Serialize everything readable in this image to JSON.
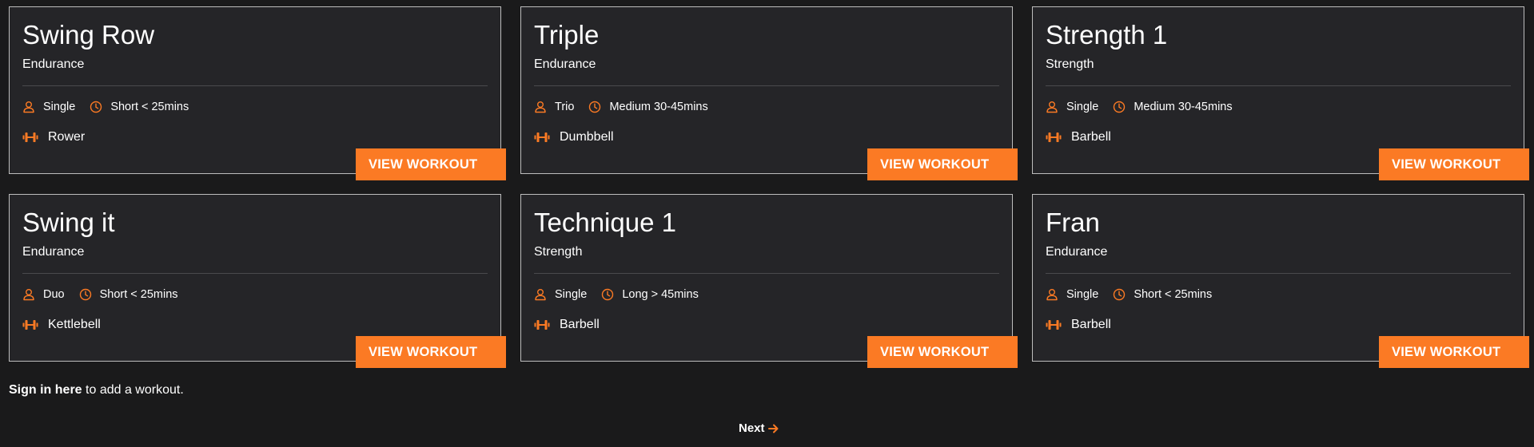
{
  "colors": {
    "accent": "#fb7a24",
    "background": "#1a1a1b",
    "card_background": "#252528",
    "card_border": "#bdbdbd"
  },
  "workouts": [
    {
      "title": "Swing Row",
      "category": "Endurance",
      "participants": "Single",
      "duration": "Short < 25mins",
      "equipment": "Rower",
      "button_label": "VIEW WORKOUT"
    },
    {
      "title": "Triple",
      "category": "Endurance",
      "participants": "Trio",
      "duration": "Medium 30-45mins",
      "equipment": "Dumbbell",
      "button_label": "VIEW WORKOUT"
    },
    {
      "title": "Strength 1",
      "category": "Strength",
      "participants": "Single",
      "duration": "Medium 30-45mins",
      "equipment": "Barbell",
      "button_label": "VIEW WORKOUT"
    },
    {
      "title": "Swing it",
      "category": "Endurance",
      "participants": "Duo",
      "duration": "Short < 25mins",
      "equipment": "Kettlebell",
      "button_label": "VIEW WORKOUT"
    },
    {
      "title": "Technique 1",
      "category": "Strength",
      "participants": "Single",
      "duration": "Long > 45mins",
      "equipment": "Barbell",
      "button_label": "VIEW WORKOUT"
    },
    {
      "title": "Fran",
      "category": "Endurance",
      "participants": "Single",
      "duration": "Short < 25mins",
      "equipment": "Barbell",
      "button_label": "VIEW WORKOUT"
    }
  ],
  "icons": {
    "participants": "user-icon",
    "duration": "clock-icon",
    "equipment": "dumbbell-icon",
    "next": "arrow-right-icon"
  },
  "footer": {
    "signin_link": "Sign in here",
    "signin_text": " to add a workout.",
    "next_label": "Next"
  }
}
